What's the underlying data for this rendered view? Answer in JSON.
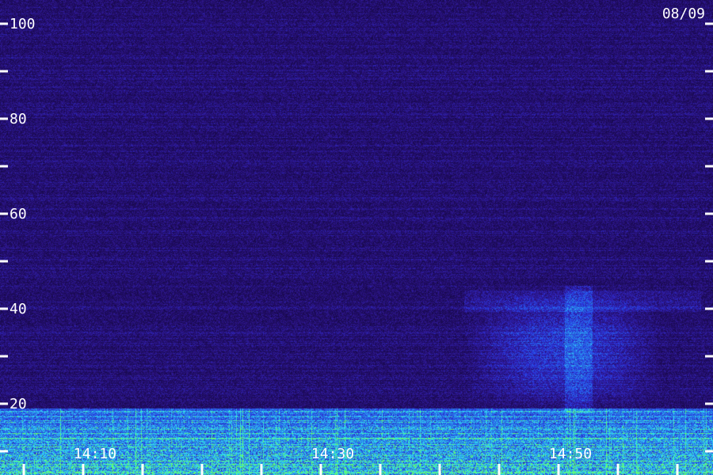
{
  "chart_data": {
    "type": "heatmap",
    "date_label": "08/09",
    "y_ticks": [
      20,
      40,
      60,
      80,
      100
    ],
    "y_minor_ticks": [
      10,
      30,
      50,
      70,
      90
    ],
    "ylim": [
      0,
      100
    ],
    "x_ticks": [
      "14:10",
      "14:30",
      "14:50"
    ],
    "xlim": [
      "14:02",
      "15:02"
    ],
    "features": [
      {
        "name": "low-frequency noise band",
        "y_range": [
          0,
          19
        ],
        "x_range": [
          "14:02",
          "15:02"
        ]
      },
      {
        "name": "broadband emission patch",
        "y_range": [
          18,
          45
        ],
        "x_range": [
          "14:41",
          "15:01"
        ]
      }
    ],
    "colors": {
      "background": "#1c0c4f",
      "noise_low": "#3a1d9a",
      "band_blue": "#2f5bff",
      "band_cyan": "#3ce6ff",
      "band_green": "#70ff70",
      "tick": "#ffffff"
    }
  }
}
